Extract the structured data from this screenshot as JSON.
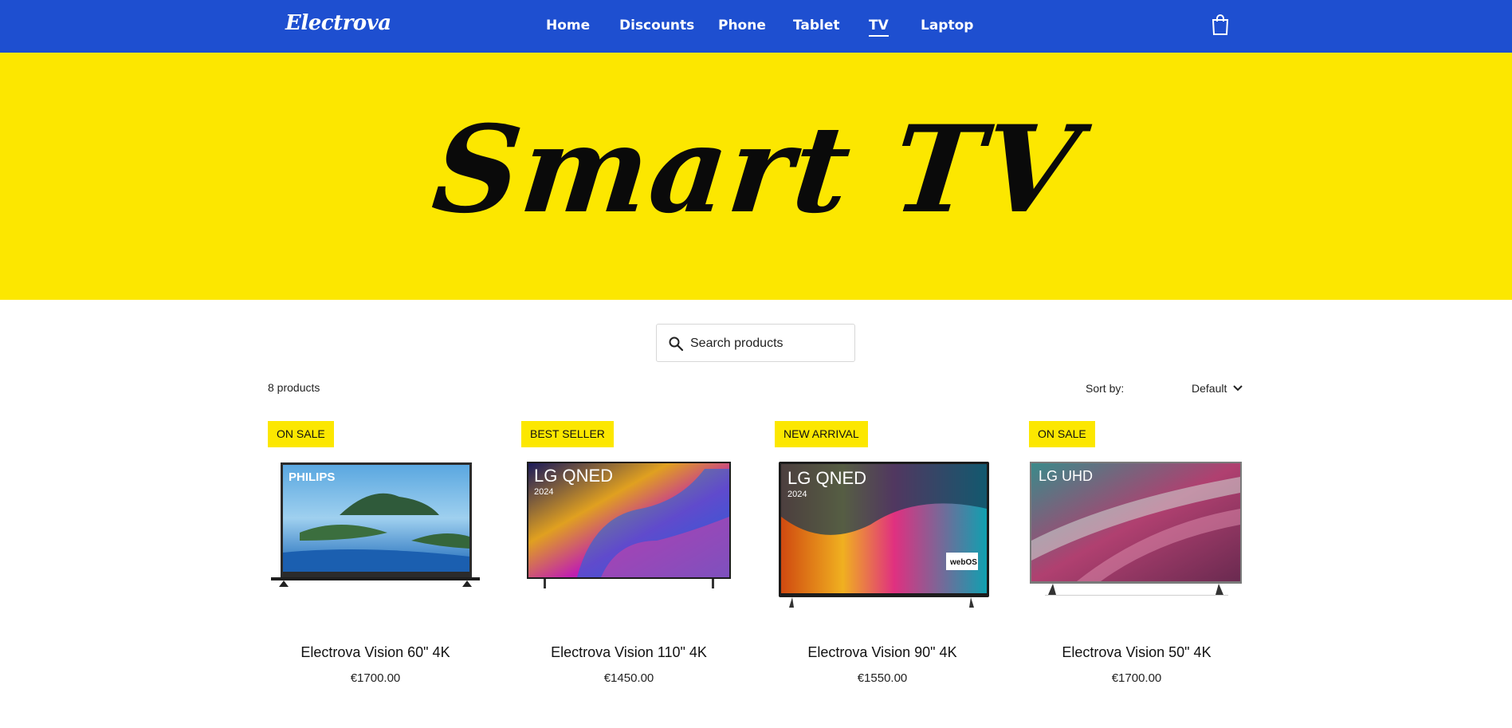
{
  "header": {
    "logo": "Electrova",
    "nav": [
      {
        "label": "Home",
        "active": false
      },
      {
        "label": "Discounts",
        "active": false
      },
      {
        "label": "Phone",
        "active": false
      },
      {
        "label": "Tablet",
        "active": false
      },
      {
        "label": "TV",
        "active": true
      },
      {
        "label": "Laptop",
        "active": false
      }
    ],
    "cart_icon": "shopping-bag-icon"
  },
  "hero": {
    "title": "Smart TV",
    "background": "#fce700"
  },
  "search": {
    "placeholder": "Search products",
    "icon": "search-icon"
  },
  "listing": {
    "count_text": "8 products",
    "sort_label": "Sort by:",
    "sort_value": "Default"
  },
  "products": [
    {
      "badge": "ON SALE",
      "brand_text": "PHILIPS",
      "name": "Electrova Vision 60\" 4K",
      "price": "€1700.00"
    },
    {
      "badge": "BEST SELLER",
      "brand_text": "LG QNED",
      "name": "Electrova Vision 110\" 4K",
      "price": "€1450.00"
    },
    {
      "badge": "NEW ARRIVAL",
      "brand_text": "LG QNED",
      "name": "Electrova Vision 90\" 4K",
      "price": "€1550.00"
    },
    {
      "badge": "ON SALE",
      "brand_text": "LG UHD",
      "name": "Electrova Vision 50\" 4K",
      "price": "€1700.00"
    }
  ],
  "colors": {
    "nav_blue": "#1e4fd0",
    "accent_yellow": "#fce700"
  }
}
